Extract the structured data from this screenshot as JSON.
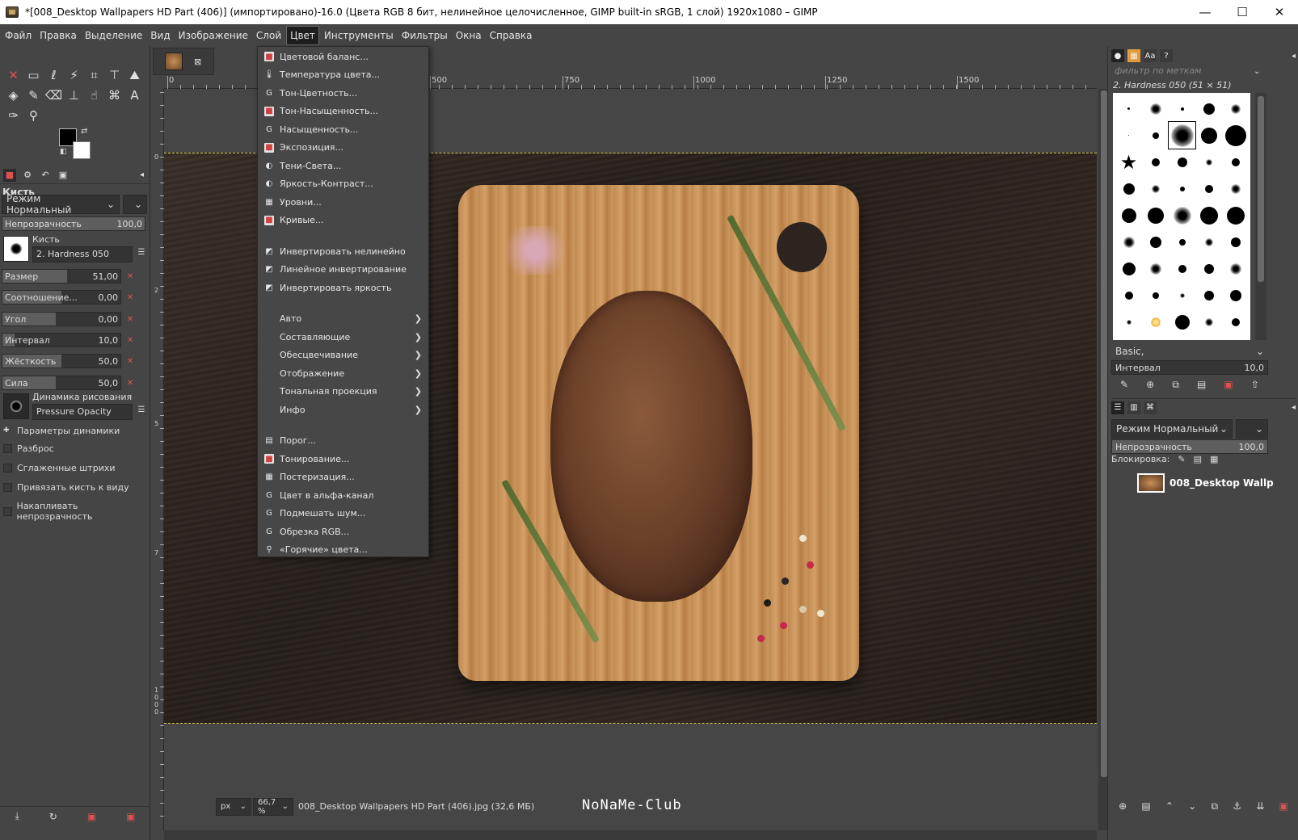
{
  "window": {
    "title": "*[008_Desktop Wallpapers  HD Part (406)] (импортировано)-16.0 (Цвета RGB 8 бит, нелинейное целочисленное, GIMP built-in sRGB, 1 слой) 1920x1080 – GIMP",
    "minimize": "—",
    "maximize": "☐",
    "close": "✕"
  },
  "menubar": [
    "Файл",
    "Правка",
    "Выделение",
    "Вид",
    "Изображение",
    "Слой",
    "Цвет",
    "Инструменты",
    "Фильтры",
    "Окна",
    "Справка"
  ],
  "active_menu": "Цвет",
  "color_menu": {
    "items": [
      {
        "label": "Цветовой баланс...",
        "icon": "color-balance-icon",
        "glyph": "■",
        "red": true
      },
      {
        "label": "Температура цвета...",
        "icon": "color-temperature-icon",
        "glyph": "🌡",
        "red": false
      },
      {
        "label": "Тон-Цветность...",
        "icon": "gegl-icon",
        "glyph": "G",
        "red": false
      },
      {
        "label": "Тон-Насыщенность...",
        "icon": "hue-saturation-icon",
        "glyph": "■",
        "red": true
      },
      {
        "label": "Насыщенность...",
        "icon": "gegl-icon",
        "glyph": "G",
        "red": false
      },
      {
        "label": "Экспозиция...",
        "icon": "exposure-icon",
        "glyph": "■",
        "red": true
      },
      {
        "label": "Тени-Света...",
        "icon": "shadows-highlights-icon",
        "glyph": "◐",
        "red": false
      },
      {
        "label": "Яркость-Контраст...",
        "icon": "brightness-contrast-icon",
        "glyph": "◐",
        "red": false
      },
      {
        "label": "Уровни...",
        "icon": "levels-icon",
        "glyph": "▦",
        "red": false
      },
      {
        "label": "Кривые...",
        "icon": "curves-icon",
        "glyph": "■",
        "red": true
      },
      {
        "label": "Инвертировать нелинейно",
        "icon": "invert-icon",
        "glyph": "◩",
        "red": false
      },
      {
        "label": "Линейное инвертирование",
        "icon": "linear-invert-icon",
        "glyph": "◩",
        "red": false
      },
      {
        "label": "Инвертировать яркость",
        "icon": "value-invert-icon",
        "glyph": "◩",
        "red": false
      },
      {
        "label": "Авто",
        "submenu": true
      },
      {
        "label": "Составляющие",
        "submenu": true
      },
      {
        "label": "Обесцвечивание",
        "submenu": true
      },
      {
        "label": "Отображение",
        "submenu": true
      },
      {
        "label": "Тональная проекция",
        "submenu": true
      },
      {
        "label": "Инфо",
        "submenu": true
      },
      {
        "label": "Порог...",
        "icon": "threshold-icon",
        "glyph": "▤",
        "red": false
      },
      {
        "label": "Тонирование...",
        "icon": "colorize-icon",
        "glyph": "■",
        "red": true
      },
      {
        "label": "Постеризация...",
        "icon": "posterize-icon",
        "glyph": "▦",
        "red": false
      },
      {
        "label": "Цвет в альфа-канал",
        "icon": "gegl-icon",
        "glyph": "G",
        "red": false
      },
      {
        "label": "Подмешать шум...",
        "icon": "gegl-icon",
        "glyph": "G",
        "red": false
      },
      {
        "label": "Обрезка RGB...",
        "icon": "gegl-icon",
        "glyph": "G",
        "red": false
      },
      {
        "label": "«Горячие» цвета...",
        "icon": "hot-colors-icon",
        "glyph": "⚲",
        "red": false
      }
    ]
  },
  "tool_options": {
    "title": "Кисть",
    "mode": "Режим Нормальный",
    "opacity_label": "Непрозрачность",
    "opacity_value": "100,0",
    "opacity_fraction": 1.0,
    "brush_label": "Кисть",
    "brush_name": "2. Hardness 050",
    "sliders": [
      {
        "label": "Размер",
        "value": "51,00",
        "fraction": 0.55
      },
      {
        "label": "Соотношение...",
        "value": "0,00",
        "fraction": 0.5
      },
      {
        "label": "Угол",
        "value": "0,00",
        "fraction": 0.45
      },
      {
        "label": "Интервал",
        "value": "10,0",
        "fraction": 0.1
      },
      {
        "label": "Жёсткость",
        "value": "50,0",
        "fraction": 0.5
      },
      {
        "label": "Сила",
        "value": "50,0",
        "fraction": 0.45
      }
    ],
    "dynamics_label": "Динамика рисования",
    "dynamics_name": "Pressure Opacity",
    "options": [
      "Параметры динамики",
      "Разброс",
      "Сглаженные штрихи",
      "Привязать кисть к виду",
      "Накапливать непрозрачность"
    ]
  },
  "ruler": {
    "h_labels": [
      "0",
      "500",
      "750",
      "1000",
      "1250",
      "1500"
    ],
    "v_labels": [
      "0",
      "2",
      "5",
      "7",
      "1000"
    ]
  },
  "statusbar": {
    "unit": "px",
    "zoom": "66,7 %",
    "file_info": "008_Desktop Wallpapers  HD Part (406).jpg (32,6 МБ)",
    "watermark": "NoNaMe-Club"
  },
  "brushes_dock": {
    "filter_placeholder": "фильтр по меткам",
    "brush_info": "2. Hardness 050 (51 × 51)",
    "preset": "Basic,",
    "spacing_label": "Интервал",
    "spacing_value": "10,0"
  },
  "layers_dock": {
    "mode": "Режим  Нормальный",
    "opacity_label": "Непрозрачность",
    "opacity_value": "100,0",
    "lock_label": "Блокировка:",
    "layer_name": "008_Desktop Wallp"
  },
  "colors": {
    "ui_bg": "#454545",
    "selection_border": "#d6c94a",
    "fg_color": "#000000",
    "bg_color": "#ffffff"
  }
}
